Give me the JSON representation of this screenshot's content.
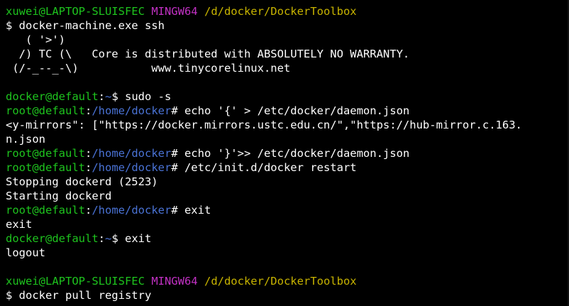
{
  "colors": {
    "background": "#000000",
    "text": "#ffffff",
    "user_host": "#1ec41e",
    "mingw": "#c231c4",
    "path_yellow": "#c8b400",
    "path_blue": "#4a73d6"
  },
  "lines": [
    {
      "segments": [
        {
          "text": "xuwei@LAPTOP-SLUISFEC",
          "color": "#1ec41e"
        },
        {
          "text": " ",
          "color": "#ffffff"
        },
        {
          "text": "MINGW64",
          "color": "#c231c4"
        },
        {
          "text": " ",
          "color": "#ffffff"
        },
        {
          "text": "/d/docker/DockerToolbox",
          "color": "#c8b400"
        }
      ]
    },
    {
      "segments": [
        {
          "text": "$ docker-machine.exe ssh",
          "color": "#ffffff"
        }
      ]
    },
    {
      "segments": [
        {
          "text": "   ( '>')",
          "color": "#ffffff"
        }
      ]
    },
    {
      "segments": [
        {
          "text": "  /) TC (\\   Core is distributed with ABSOLUTELY NO WARRANTY.",
          "color": "#ffffff"
        }
      ]
    },
    {
      "segments": [
        {
          "text": " (/-_--_-\\)           www.tinycorelinux.net",
          "color": "#ffffff"
        }
      ]
    },
    {
      "segments": [
        {
          "text": "",
          "color": "#ffffff"
        }
      ]
    },
    {
      "segments": [
        {
          "text": "docker@default",
          "color": "#1ec41e"
        },
        {
          "text": ":",
          "color": "#ffffff"
        },
        {
          "text": "~",
          "color": "#4a73d6"
        },
        {
          "text": "$ sudo -s",
          "color": "#ffffff"
        }
      ]
    },
    {
      "segments": [
        {
          "text": "root@default",
          "color": "#1ec41e"
        },
        {
          "text": ":",
          "color": "#ffffff"
        },
        {
          "text": "/home/docker",
          "color": "#4a73d6"
        },
        {
          "text": "# echo '{' > /etc/docker/daemon.json",
          "color": "#ffffff"
        }
      ]
    },
    {
      "segments": [
        {
          "text": "<y-mirrors\": [\"https://docker.mirrors.ustc.edu.cn/\",\"https://hub-mirror.c.163.",
          "color": "#ffffff"
        }
      ]
    },
    {
      "segments": [
        {
          "text": "n.json",
          "color": "#ffffff"
        }
      ]
    },
    {
      "segments": [
        {
          "text": "root@default",
          "color": "#1ec41e"
        },
        {
          "text": ":",
          "color": "#ffffff"
        },
        {
          "text": "/home/docker",
          "color": "#4a73d6"
        },
        {
          "text": "# echo '}'>> /etc/docker/daemon.json",
          "color": "#ffffff"
        }
      ]
    },
    {
      "segments": [
        {
          "text": "root@default",
          "color": "#1ec41e"
        },
        {
          "text": ":",
          "color": "#ffffff"
        },
        {
          "text": "/home/docker",
          "color": "#4a73d6"
        },
        {
          "text": "# /etc/init.d/docker restart",
          "color": "#ffffff"
        }
      ]
    },
    {
      "segments": [
        {
          "text": "Stopping dockerd (2523)",
          "color": "#ffffff"
        }
      ]
    },
    {
      "segments": [
        {
          "text": "Starting dockerd",
          "color": "#ffffff"
        }
      ]
    },
    {
      "segments": [
        {
          "text": "root@default",
          "color": "#1ec41e"
        },
        {
          "text": ":",
          "color": "#ffffff"
        },
        {
          "text": "/home/docker",
          "color": "#4a73d6"
        },
        {
          "text": "# exit",
          "color": "#ffffff"
        }
      ]
    },
    {
      "segments": [
        {
          "text": "exit",
          "color": "#ffffff"
        }
      ]
    },
    {
      "segments": [
        {
          "text": "docker@default",
          "color": "#1ec41e"
        },
        {
          "text": ":",
          "color": "#ffffff"
        },
        {
          "text": "~",
          "color": "#4a73d6"
        },
        {
          "text": "$ exit",
          "color": "#ffffff"
        }
      ]
    },
    {
      "segments": [
        {
          "text": "logout",
          "color": "#ffffff"
        }
      ]
    },
    {
      "segments": [
        {
          "text": "",
          "color": "#ffffff"
        }
      ]
    },
    {
      "segments": [
        {
          "text": "xuwei@LAPTOP-SLUISFEC",
          "color": "#1ec41e"
        },
        {
          "text": " ",
          "color": "#ffffff"
        },
        {
          "text": "MINGW64",
          "color": "#c231c4"
        },
        {
          "text": " ",
          "color": "#ffffff"
        },
        {
          "text": "/d/docker/DockerToolbox",
          "color": "#c8b400"
        }
      ]
    },
    {
      "segments": [
        {
          "text": "$ docker pull registry",
          "color": "#ffffff"
        }
      ]
    }
  ]
}
